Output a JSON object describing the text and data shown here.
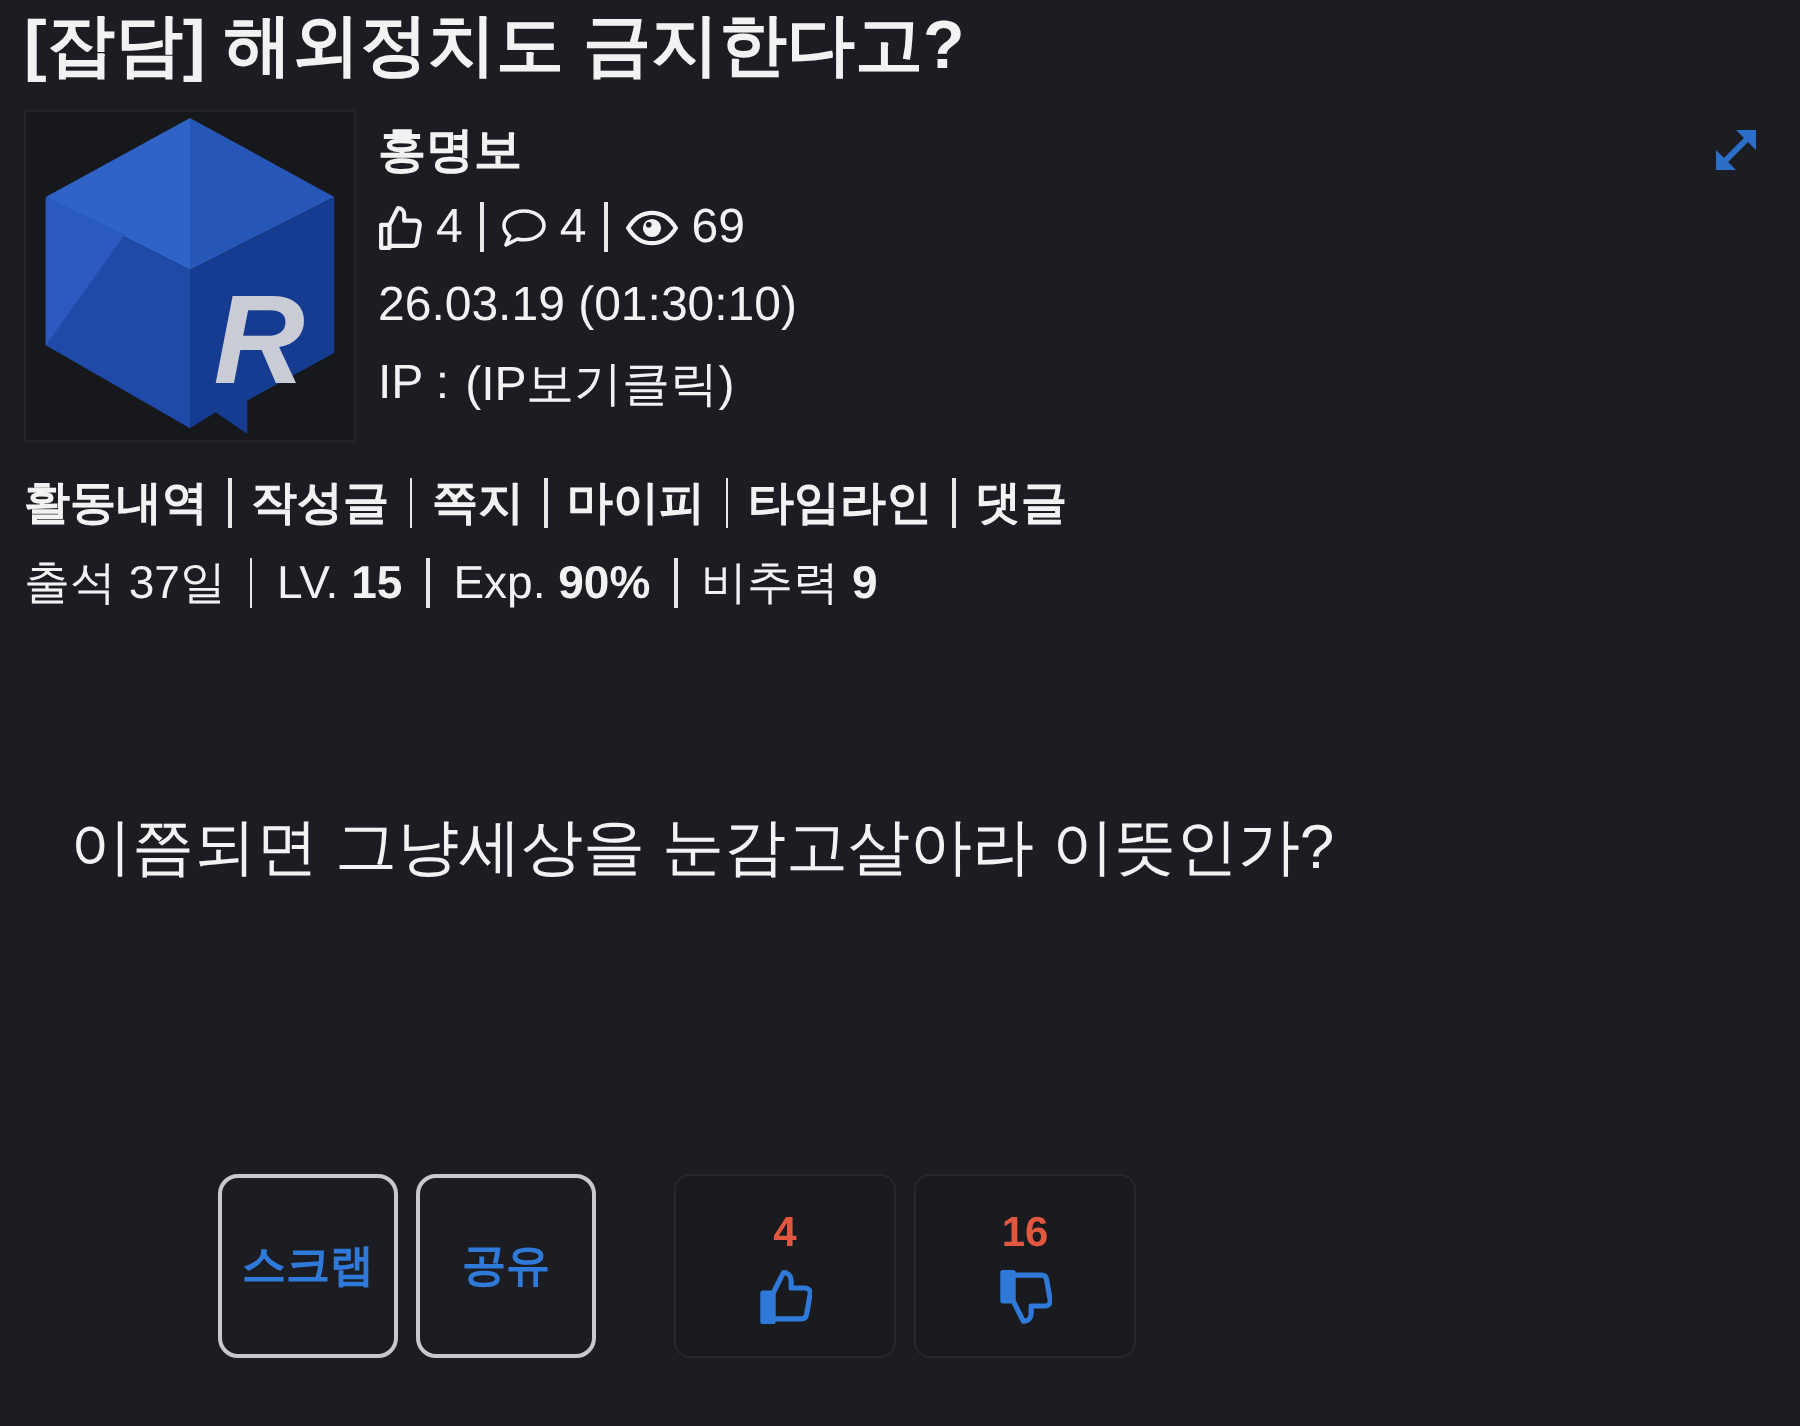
{
  "title": "[잡담] 해외정치도 금지한다고?",
  "author": {
    "avatar_letter": "R",
    "name": "홍명보",
    "stats": [
      {
        "kind": "likes",
        "value": "4"
      },
      {
        "kind": "comments",
        "value": "4"
      },
      {
        "kind": "views",
        "value": "69"
      }
    ],
    "date": "26.03.19 (01:30:10)",
    "ip_label": "IP :",
    "ip_link": "(IP보기클릭)"
  },
  "profile_links": [
    "활동내역",
    "작성글",
    "쪽지",
    "마이피",
    "타임라인",
    "댓글"
  ],
  "profile_stats": [
    "출석 37일",
    "LV. **15**",
    "Exp. **90%**",
    "비추력 **9**"
  ],
  "body": "이쯤되면 그냥세상을 눈감고살아라 이뜻인가?",
  "actions": [
    "스크랩",
    "공유"
  ],
  "votes": [
    {
      "kind": "up",
      "count": "4"
    },
    {
      "kind": "down",
      "count": "16"
    }
  ]
}
